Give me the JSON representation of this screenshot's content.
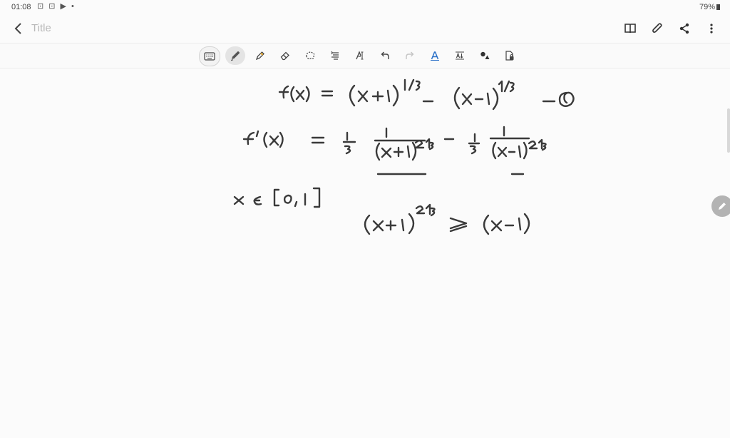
{
  "status_bar": {
    "time": "01:08",
    "battery": "79%"
  },
  "header": {
    "title": "Title"
  },
  "toolbar": {
    "tools": [
      "keyboard-icon",
      "pen-icon",
      "highlighter-icon",
      "eraser-icon",
      "lasso-icon",
      "shapes-icon",
      "text-icon",
      "undo-icon",
      "redo-icon",
      "smart-select-icon",
      "text-convert-icon",
      "color-icon",
      "page-lock-icon"
    ],
    "selected": "pen-icon"
  },
  "note": {
    "lines": [
      "f(x) = (x+1)^1/3 − (x−1)^1/3  —①",
      "f′(x) = 1/3 · 1/(x+1)^2/3 − 1/3 · 1/(x−1)^2/3",
      "x ∈ [0,1]",
      "(x+1)^2/3 ≥ (x−1)"
    ]
  },
  "colors": {
    "ink": "#3a3a3a",
    "accent_pen": "#8a8a8a"
  }
}
